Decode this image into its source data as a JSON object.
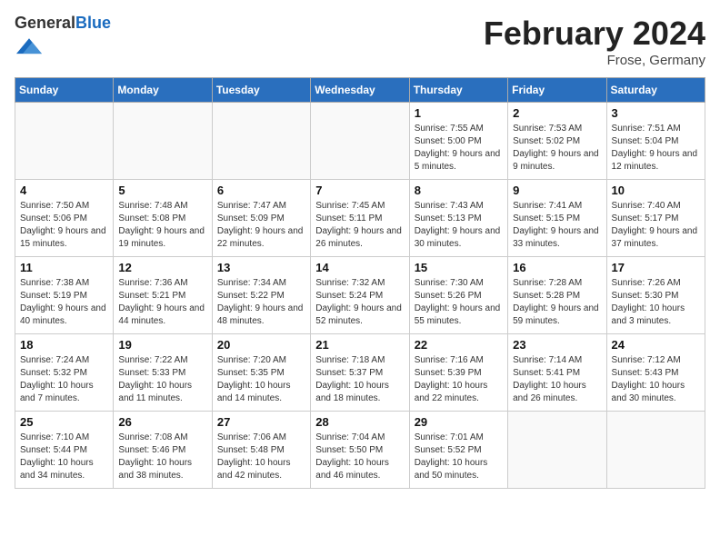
{
  "header": {
    "logo_general": "General",
    "logo_blue": "Blue",
    "title": "February 2024",
    "subtitle": "Frose, Germany"
  },
  "days_of_week": [
    "Sunday",
    "Monday",
    "Tuesday",
    "Wednesday",
    "Thursday",
    "Friday",
    "Saturday"
  ],
  "weeks": [
    [
      {
        "day": "",
        "info": ""
      },
      {
        "day": "",
        "info": ""
      },
      {
        "day": "",
        "info": ""
      },
      {
        "day": "",
        "info": ""
      },
      {
        "day": "1",
        "info": "Sunrise: 7:55 AM\nSunset: 5:00 PM\nDaylight: 9 hours and 5 minutes."
      },
      {
        "day": "2",
        "info": "Sunrise: 7:53 AM\nSunset: 5:02 PM\nDaylight: 9 hours and 9 minutes."
      },
      {
        "day": "3",
        "info": "Sunrise: 7:51 AM\nSunset: 5:04 PM\nDaylight: 9 hours and 12 minutes."
      }
    ],
    [
      {
        "day": "4",
        "info": "Sunrise: 7:50 AM\nSunset: 5:06 PM\nDaylight: 9 hours and 15 minutes."
      },
      {
        "day": "5",
        "info": "Sunrise: 7:48 AM\nSunset: 5:08 PM\nDaylight: 9 hours and 19 minutes."
      },
      {
        "day": "6",
        "info": "Sunrise: 7:47 AM\nSunset: 5:09 PM\nDaylight: 9 hours and 22 minutes."
      },
      {
        "day": "7",
        "info": "Sunrise: 7:45 AM\nSunset: 5:11 PM\nDaylight: 9 hours and 26 minutes."
      },
      {
        "day": "8",
        "info": "Sunrise: 7:43 AM\nSunset: 5:13 PM\nDaylight: 9 hours and 30 minutes."
      },
      {
        "day": "9",
        "info": "Sunrise: 7:41 AM\nSunset: 5:15 PM\nDaylight: 9 hours and 33 minutes."
      },
      {
        "day": "10",
        "info": "Sunrise: 7:40 AM\nSunset: 5:17 PM\nDaylight: 9 hours and 37 minutes."
      }
    ],
    [
      {
        "day": "11",
        "info": "Sunrise: 7:38 AM\nSunset: 5:19 PM\nDaylight: 9 hours and 40 minutes."
      },
      {
        "day": "12",
        "info": "Sunrise: 7:36 AM\nSunset: 5:21 PM\nDaylight: 9 hours and 44 minutes."
      },
      {
        "day": "13",
        "info": "Sunrise: 7:34 AM\nSunset: 5:22 PM\nDaylight: 9 hours and 48 minutes."
      },
      {
        "day": "14",
        "info": "Sunrise: 7:32 AM\nSunset: 5:24 PM\nDaylight: 9 hours and 52 minutes."
      },
      {
        "day": "15",
        "info": "Sunrise: 7:30 AM\nSunset: 5:26 PM\nDaylight: 9 hours and 55 minutes."
      },
      {
        "day": "16",
        "info": "Sunrise: 7:28 AM\nSunset: 5:28 PM\nDaylight: 9 hours and 59 minutes."
      },
      {
        "day": "17",
        "info": "Sunrise: 7:26 AM\nSunset: 5:30 PM\nDaylight: 10 hours and 3 minutes."
      }
    ],
    [
      {
        "day": "18",
        "info": "Sunrise: 7:24 AM\nSunset: 5:32 PM\nDaylight: 10 hours and 7 minutes."
      },
      {
        "day": "19",
        "info": "Sunrise: 7:22 AM\nSunset: 5:33 PM\nDaylight: 10 hours and 11 minutes."
      },
      {
        "day": "20",
        "info": "Sunrise: 7:20 AM\nSunset: 5:35 PM\nDaylight: 10 hours and 14 minutes."
      },
      {
        "day": "21",
        "info": "Sunrise: 7:18 AM\nSunset: 5:37 PM\nDaylight: 10 hours and 18 minutes."
      },
      {
        "day": "22",
        "info": "Sunrise: 7:16 AM\nSunset: 5:39 PM\nDaylight: 10 hours and 22 minutes."
      },
      {
        "day": "23",
        "info": "Sunrise: 7:14 AM\nSunset: 5:41 PM\nDaylight: 10 hours and 26 minutes."
      },
      {
        "day": "24",
        "info": "Sunrise: 7:12 AM\nSunset: 5:43 PM\nDaylight: 10 hours and 30 minutes."
      }
    ],
    [
      {
        "day": "25",
        "info": "Sunrise: 7:10 AM\nSunset: 5:44 PM\nDaylight: 10 hours and 34 minutes."
      },
      {
        "day": "26",
        "info": "Sunrise: 7:08 AM\nSunset: 5:46 PM\nDaylight: 10 hours and 38 minutes."
      },
      {
        "day": "27",
        "info": "Sunrise: 7:06 AM\nSunset: 5:48 PM\nDaylight: 10 hours and 42 minutes."
      },
      {
        "day": "28",
        "info": "Sunrise: 7:04 AM\nSunset: 5:50 PM\nDaylight: 10 hours and 46 minutes."
      },
      {
        "day": "29",
        "info": "Sunrise: 7:01 AM\nSunset: 5:52 PM\nDaylight: 10 hours and 50 minutes."
      },
      {
        "day": "",
        "info": ""
      },
      {
        "day": "",
        "info": ""
      }
    ]
  ]
}
